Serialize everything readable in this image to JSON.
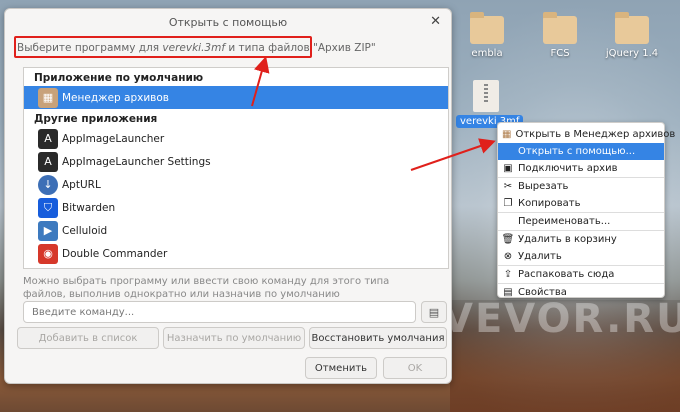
{
  "desktop": {
    "icons": [
      {
        "label": "embla"
      },
      {
        "label": "FCS"
      },
      {
        "label": "jQuery 1.4"
      },
      {
        "label": "verevki.3mf"
      }
    ],
    "watermark": "VEVOR.RU"
  },
  "dialog": {
    "title": "Открыть с помощью",
    "hint_prefix": "Выберите программу для ",
    "hint_file": "verevki.3mf",
    "hint_suffix": " и типа файлов \"Архив ZIP\"",
    "default_header": "Приложение по умолчанию",
    "default_app": "Менеджер архивов",
    "other_header": "Другие приложения",
    "apps": [
      {
        "label": "AppImageLauncher",
        "icon": "appimage-icon",
        "color": "#2a2a2a"
      },
      {
        "label": "AppImageLauncher Settings",
        "icon": "appimage-icon",
        "color": "#2a2a2a"
      },
      {
        "label": "AptURL",
        "icon": "apturl-icon",
        "color": "#3d6fb6"
      },
      {
        "label": "Bitwarden",
        "icon": "shield-icon",
        "color": "#175ddc"
      },
      {
        "label": "Celluloid",
        "icon": "film-icon",
        "color": "#3d7abf"
      },
      {
        "label": "Double Commander",
        "icon": "double-commander-icon",
        "color": "#d6382a"
      }
    ],
    "description": "Можно выбрать программу или ввести свою команду для этого типа файлов, выполнив однократно или назначив по умолчанию",
    "command_placeholder": "Введите команду...",
    "btn_add": "Добавить в список",
    "btn_set_default": "Назначить по умолчанию",
    "btn_restore": "Восстановить умолчания",
    "btn_cancel": "Отменить",
    "btn_ok": "OK"
  },
  "context_menu": {
    "items": [
      {
        "label": "Открыть в Менеджер архивов",
        "icon": "archive-icon"
      },
      {
        "label": "Открыть с помощью...",
        "icon": "",
        "highlighted": true
      },
      {
        "label": "Подключить архив",
        "icon": "mount-icon"
      },
      {
        "label": "Вырезать",
        "icon": "scissors-icon"
      },
      {
        "label": "Копировать",
        "icon": "copy-icon"
      },
      {
        "label": "Переименовать...",
        "icon": ""
      },
      {
        "label": "Удалить в корзину",
        "icon": "trash-icon"
      },
      {
        "label": "Удалить",
        "icon": "delete-icon"
      },
      {
        "label": "Распаковать сюда",
        "icon": "extract-icon"
      },
      {
        "label": "Свойства",
        "icon": "properties-icon"
      }
    ]
  },
  "colors": {
    "accent": "#3584e4",
    "annotation": "#e0201b"
  }
}
